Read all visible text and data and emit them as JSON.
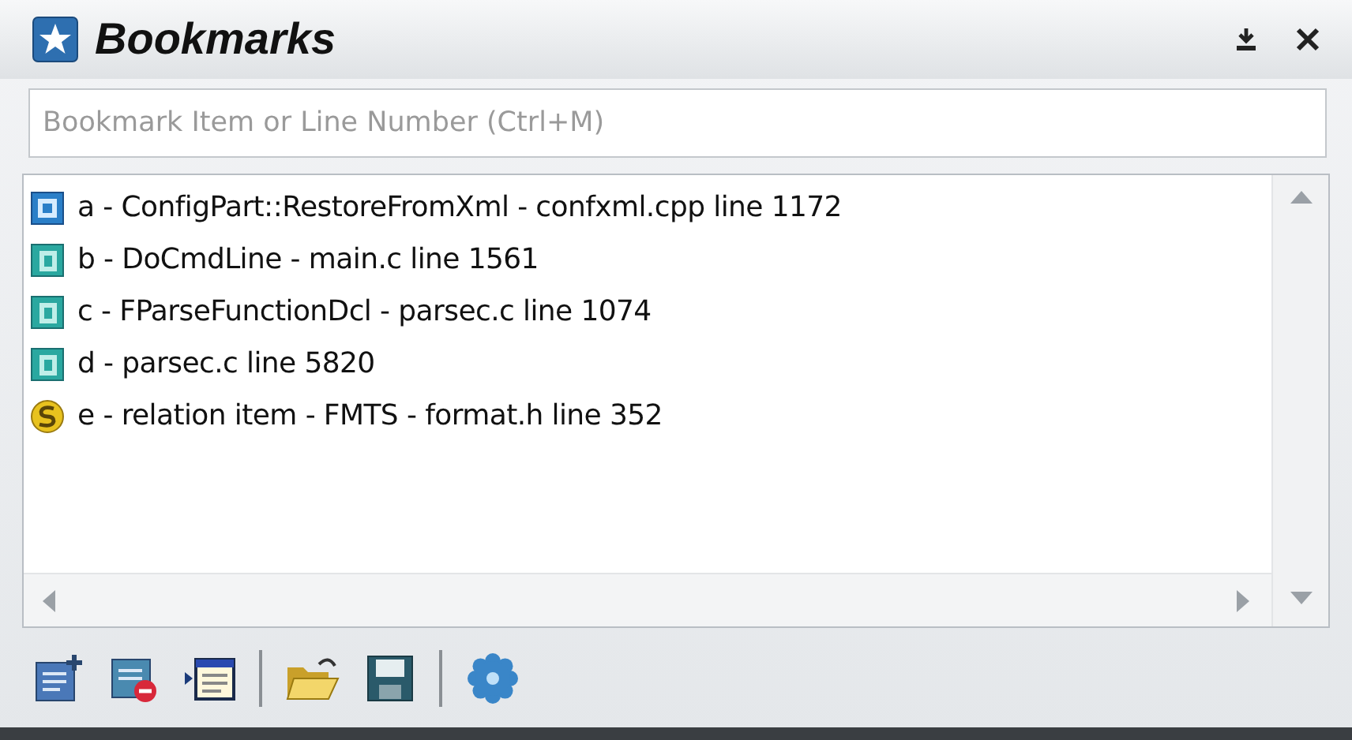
{
  "panel": {
    "title": "Bookmarks"
  },
  "search": {
    "placeholder": "Bookmark Item or Line Number (Ctrl+M)"
  },
  "bookmarks": [
    {
      "kind": "class",
      "label": "a - ConfigPart::RestoreFromXml - confxml.cpp line 1172"
    },
    {
      "kind": "function",
      "label": "b - DoCmdLine - main.c line 1561"
    },
    {
      "kind": "function",
      "label": "c - FParseFunctionDcl - parsec.c line 1074"
    },
    {
      "kind": "function",
      "label": "d - parsec.c line 5820"
    },
    {
      "kind": "symbol",
      "label": "e - relation item - FMTS - format.h line 352"
    }
  ]
}
